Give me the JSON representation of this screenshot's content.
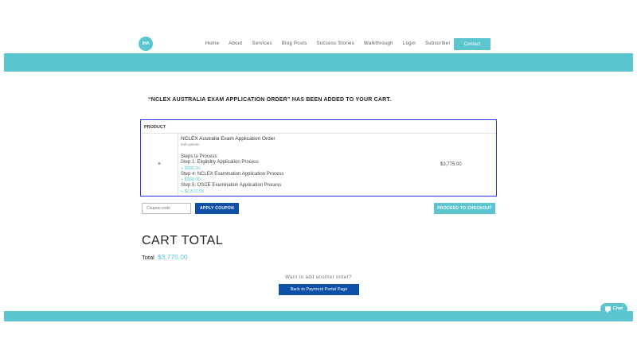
{
  "nav": {
    "logo_text": "IHA",
    "items": [
      "Home",
      "About",
      "Services",
      "Blog Posts",
      "Success Stories",
      "Walkthrough",
      "Login",
      "Subscribe!"
    ],
    "contact_label": "Contact"
  },
  "notice": "“NCLEX AUSTRALIA EXAM APPLICATION ORDER” HAS BEEN ADDED TO YOUR CART.",
  "cart": {
    "header": "PRODUCT",
    "remove_symbol": "×",
    "product_name": "NCLEX Australia Exam Application Order",
    "edit_label": "Edit options",
    "steps_heading": "Steps to Process:",
    "steps": [
      {
        "label": "Step 1: Eligibility Application Process",
        "price": "+ $585.00"
      },
      {
        "label": "Step 4: NCLEX Examination Application Process",
        "price": "+ $380.00"
      },
      {
        "label": "Step 5: OSCE Examination Application Process",
        "price": "+ $2,810.00"
      }
    ],
    "price": "$3,775.00"
  },
  "coupon": {
    "placeholder": "Coupon code",
    "apply_label": "APPLY COUPON"
  },
  "checkout_label": "PROCEED TO CHECKOUT",
  "totals": {
    "title": "CART TOTAL",
    "label": "Total",
    "amount": "$3,775.00"
  },
  "another_order": {
    "prompt": "Want to add another order?",
    "button": "Back to Payment Portal Page"
  },
  "chat_label": "Chat",
  "colors": {
    "accent": "#5bc5d0",
    "primary_button": "#0e4fa8",
    "focus_border": "#2d35d6"
  }
}
